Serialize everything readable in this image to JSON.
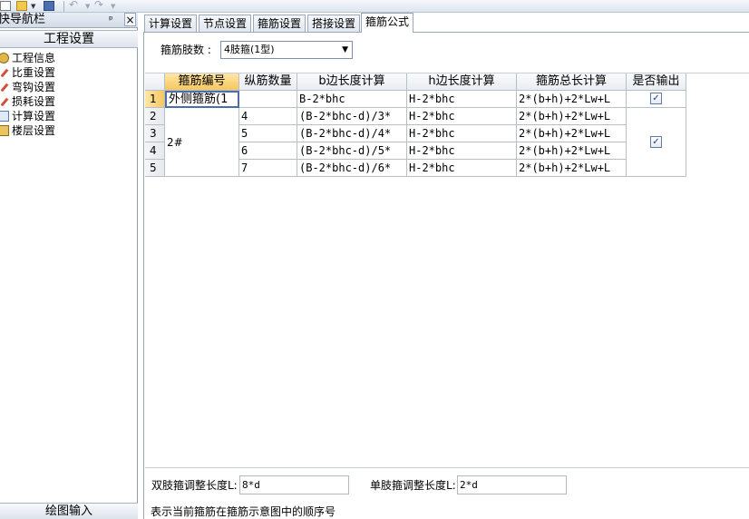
{
  "toolbar": {
    "icons": [
      "new-icon",
      "open-folder-icon",
      "save-icon",
      "undo-icon",
      "redo-icon"
    ]
  },
  "nav": {
    "title": "快导航栏",
    "pin_glyph": "ᵖ",
    "close_glyph": "×",
    "section": "工程设置",
    "items": [
      {
        "label": "工程信息",
        "icon": "info-icon"
      },
      {
        "label": "比重设置",
        "icon": "pencil-icon"
      },
      {
        "label": "弯钩设置",
        "icon": "pencil-icon"
      },
      {
        "label": "损耗设置",
        "icon": "pencil-icon"
      },
      {
        "label": "计算设置",
        "icon": "calc-icon"
      },
      {
        "label": "楼层设置",
        "icon": "floor-icon"
      }
    ],
    "bottom": "绘图输入"
  },
  "tabs": [
    {
      "label": "计算设置",
      "active": false
    },
    {
      "label": "节点设置",
      "active": false
    },
    {
      "label": "箍筋设置",
      "active": false
    },
    {
      "label": "搭接设置",
      "active": false
    },
    {
      "label": "箍筋公式",
      "active": true
    }
  ],
  "leg": {
    "label": "箍筋肢数 :",
    "selected": "4肢箍(1型)",
    "arrow": "▼"
  },
  "grid": {
    "columns": [
      "箍筋编号",
      "纵筋数量",
      "b边长度计算",
      "h边长度计算",
      "箍筋总长计算",
      "是否输出"
    ],
    "rows": [
      {
        "no": "1",
        "id": "外侧箍筋(1",
        "count": "",
        "b": "B-2*bhc",
        "h": "H-2*bhc",
        "total": "2*(b+h)+2*Lw+L",
        "output": true
      },
      {
        "no": "2",
        "id": "2#",
        "count": "4",
        "b": "(B-2*bhc-d)/3*",
        "h": "H-2*bhc",
        "total": "2*(b+h)+2*Lw+L",
        "output": true
      },
      {
        "no": "3",
        "id": "",
        "count": "5",
        "b": "(B-2*bhc-d)/4*",
        "h": "H-2*bhc",
        "total": "2*(b+h)+2*Lw+L",
        "output": true
      },
      {
        "no": "4",
        "id": "",
        "count": "6",
        "b": "(B-2*bhc-d)/5*",
        "h": "H-2*bhc",
        "total": "2*(b+h)+2*Lw+L",
        "output": true
      },
      {
        "no": "5",
        "id": "",
        "count": "7",
        "b": "(B-2*bhc-d)/6*",
        "h": "H-2*bhc",
        "total": "2*(b+h)+2*Lw+L",
        "output": true
      }
    ],
    "check_glyph": "✓"
  },
  "adjust": {
    "double_label": "双肢箍调整长度L:",
    "double_value": "8*d",
    "single_label": "单肢箍调整长度L:",
    "single_value": "2*d"
  },
  "status": "表示当前箍筋在箍筋示意图中的顺序号",
  "colors": {
    "selected_header": "#f6c75e",
    "edit_border": "#4d6fa8",
    "panel_bg": "#dde5ef"
  }
}
